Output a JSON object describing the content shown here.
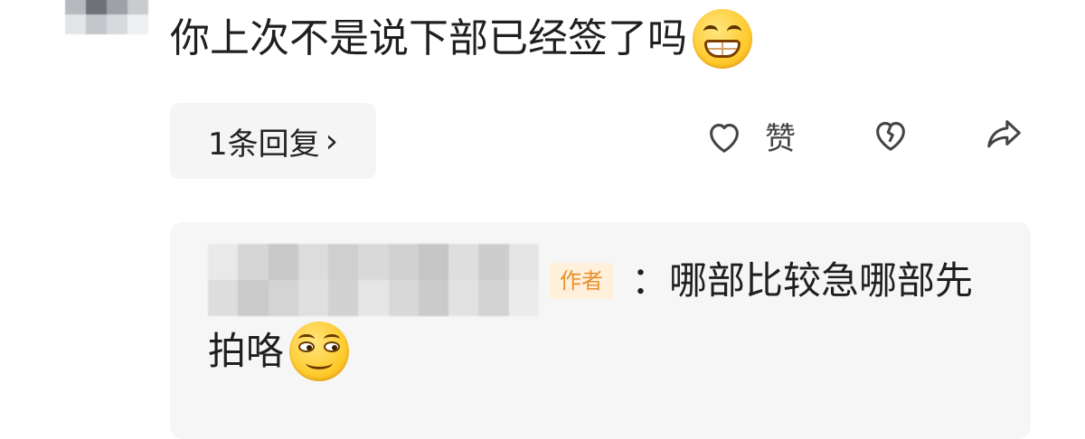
{
  "comment": {
    "text": "你上次不是说下部已经签了吗",
    "emoji": "grinning-face-icon"
  },
  "actions": {
    "reply_count_label": "1条回复",
    "reply_chevron": "›",
    "like_label": "赞",
    "like_icon": "heart-outline-icon",
    "dislike_icon": "broken-heart-icon",
    "share_icon": "share-arrow-icon"
  },
  "reply": {
    "author_badge": "作者",
    "text_line1": "：哪部比较急哪部先",
    "text_line2": "拍咯",
    "emoji": "smirk-face-icon"
  },
  "colors": {
    "badge_text": "#e8912c",
    "badge_bg": "#fff0dc",
    "reply_box_bg": "#f6f6f6",
    "button_bg": "#f5f5f5"
  }
}
